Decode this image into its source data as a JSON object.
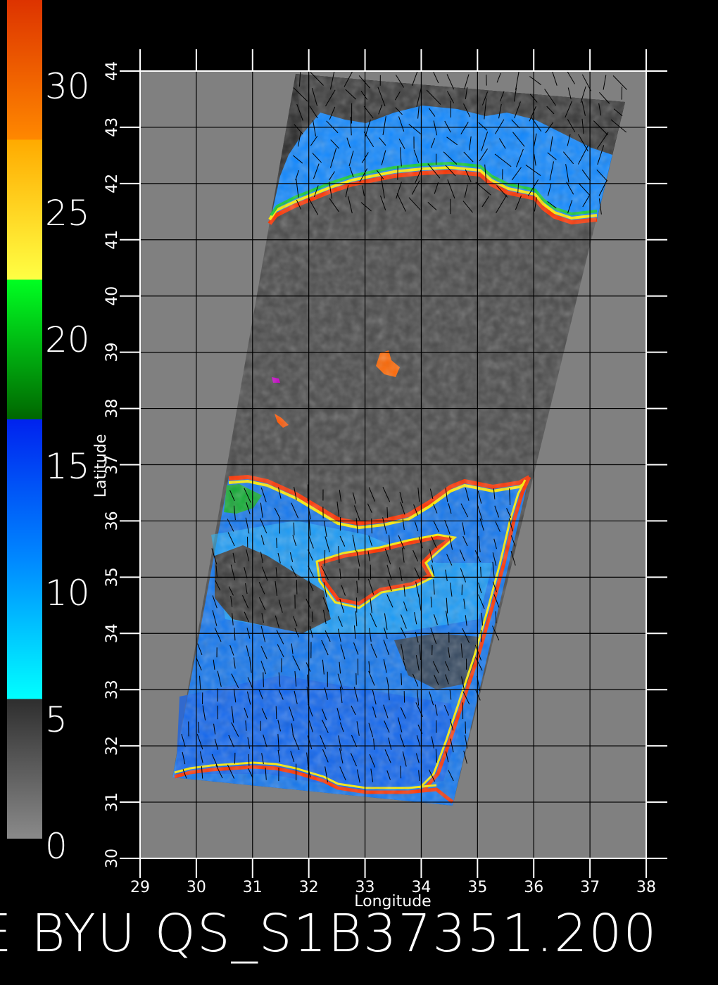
{
  "colorbar": {
    "labels": [
      "30",
      "25",
      "20",
      "15",
      "10",
      "5",
      "0"
    ],
    "stops": [
      {
        "value": 0,
        "color": "#8a8a8a"
      },
      {
        "value": 5,
        "color": "#2e2e2e"
      },
      {
        "value": 5,
        "color": "#00ffff"
      },
      {
        "value": 10,
        "color": "#0088ff"
      },
      {
        "value": 15,
        "color": "#0022ee"
      },
      {
        "value": 15,
        "color": "#006600"
      },
      {
        "value": 20,
        "color": "#00ff22"
      },
      {
        "value": 20,
        "color": "#ffff44"
      },
      {
        "value": 25,
        "color": "#ffaa00"
      },
      {
        "value": 25,
        "color": "#ff8800"
      },
      {
        "value": 30,
        "color": "#dd3300"
      },
      {
        "value": 30,
        "color": "#ff2200"
      }
    ]
  },
  "axes": {
    "xlabel": "Longitude",
    "ylabel": "Latitude",
    "x_ticks": [
      "29",
      "30",
      "31",
      "32",
      "33",
      "34",
      "35",
      "36",
      "37",
      "38"
    ],
    "y_ticks": [
      "30",
      "31",
      "32",
      "33",
      "34",
      "35",
      "36",
      "37",
      "38",
      "39",
      "40",
      "41",
      "42",
      "43",
      "44"
    ],
    "xlim": [
      29,
      38
    ],
    "ylim": [
      30,
      44
    ]
  },
  "caption": "E BYU QS_S1B37351.200",
  "colors": {
    "background": "#000000",
    "map_background": "#808080",
    "swath_land": "#4a4a4a",
    "sea_light": "#22ccff",
    "sea_mid": "#1188ff",
    "sea_deep": "#1155ee",
    "calm": "#3c3c3c"
  }
}
